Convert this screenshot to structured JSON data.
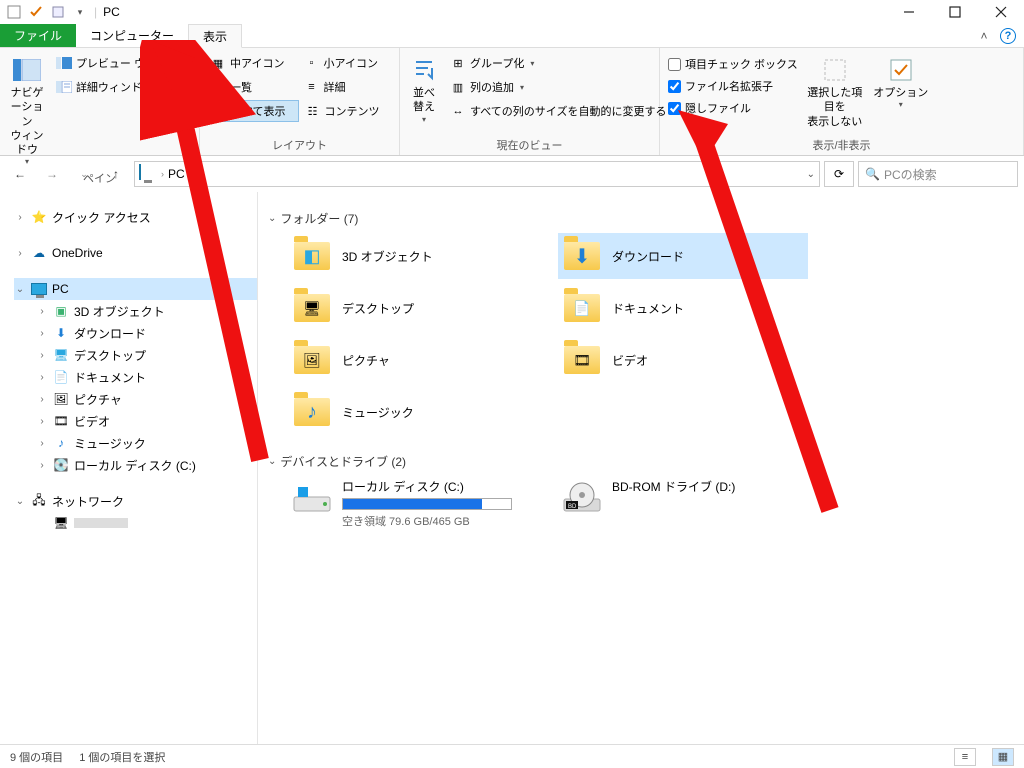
{
  "title": "PC",
  "tabs": {
    "file": "ファイル",
    "computer": "コンピューター",
    "view": "表示"
  },
  "ribbon": {
    "panes": {
      "nav_btn": "ナビゲーション\nウィンドウ",
      "preview": "プレビュー ウィンドウ",
      "details_pane": "詳細ウィンドウ",
      "label": "ペイン"
    },
    "layout": {
      "medium_icons": "中アイコン",
      "small_icons": "小アイコン",
      "list": "一覧",
      "details": "詳細",
      "tiles": "並べて表示",
      "content": "コンテンツ",
      "label": "レイアウト"
    },
    "current_view": {
      "sort": "並べ替え",
      "group_by": "グループ化",
      "add_columns": "列の追加",
      "autosize": "すべての列のサイズを自動的に変更する",
      "label": "現在のビュー"
    },
    "show_hide": {
      "item_check": "項目チェック ボックス",
      "file_ext": "ファイル名拡張子",
      "hidden_files": "隠しファイル",
      "hide_selected": "選択した項目を\n表示しない",
      "options": "オプション",
      "label": "表示/非表示"
    }
  },
  "nav": {
    "location": "PC",
    "search_placeholder": "PCの検索"
  },
  "tree": {
    "quick_access": "クイック アクセス",
    "onedrive": "OneDrive",
    "pc": "PC",
    "pc_children": [
      "3D オブジェクト",
      "ダウンロード",
      "デスクトップ",
      "ドキュメント",
      "ピクチャ",
      "ビデオ",
      "ミュージック",
      "ローカル ディスク (C:)"
    ],
    "network": "ネットワーク"
  },
  "sections": {
    "folders_header": "フォルダー (7)",
    "folders": [
      "3D オブジェクト",
      "ダウンロード",
      "デスクトップ",
      "ドキュメント",
      "ピクチャ",
      "ビデオ",
      "ミュージック"
    ],
    "drives_header": "デバイスとドライブ (2)",
    "drive_c": {
      "name": "ローカル ディスク (C:)",
      "sub": "空き領域 79.6 GB/465 GB",
      "fill_pct": 83
    },
    "drive_d": {
      "name": "BD-ROM ドライブ (D:)"
    }
  },
  "status": {
    "items": "9 個の項目",
    "selected": "1 個の項目を選択"
  }
}
